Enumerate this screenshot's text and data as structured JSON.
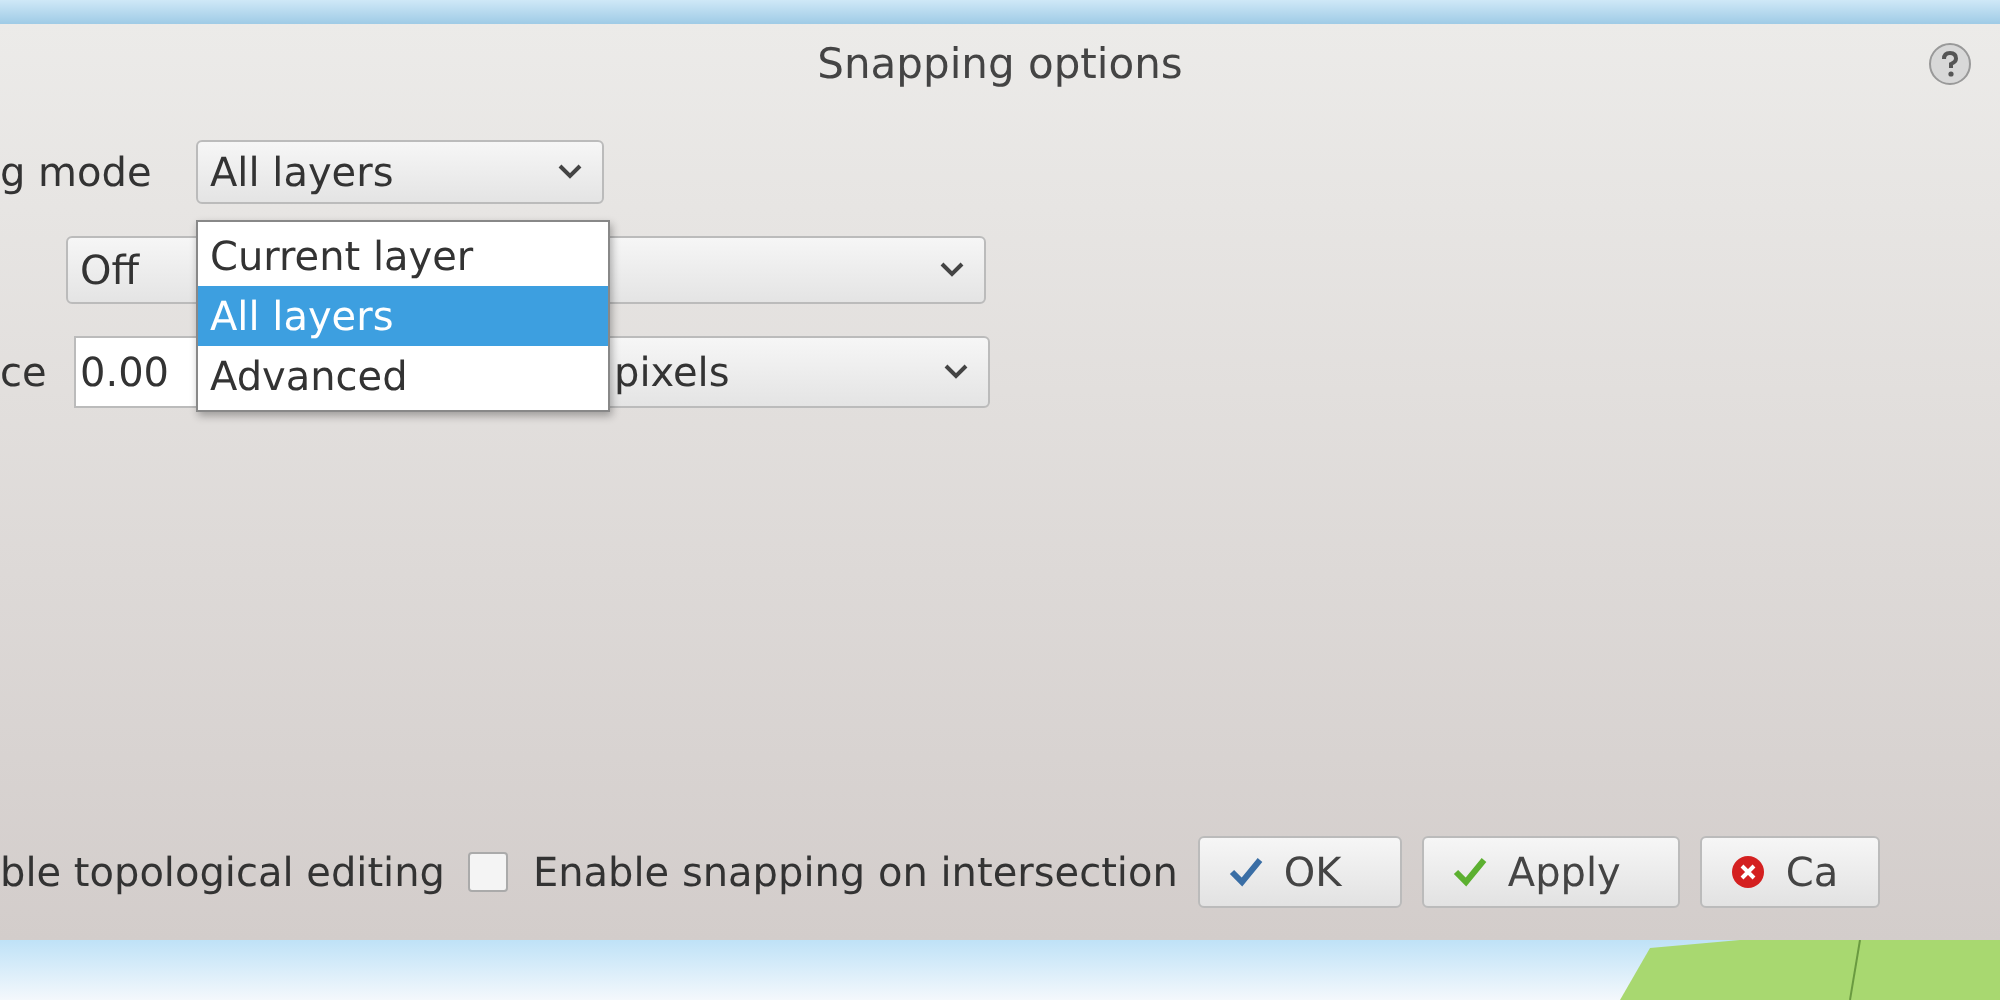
{
  "window": {
    "title": "Snapping options"
  },
  "snapping_mode": {
    "label": "g mode",
    "value": "All layers",
    "options": [
      {
        "label": "Current layer",
        "selected": false
      },
      {
        "label": "All layers",
        "selected": true
      },
      {
        "label": "Advanced",
        "selected": false
      }
    ]
  },
  "snap_to": {
    "value": "Off"
  },
  "tolerance": {
    "label": "ce",
    "value": "0.00",
    "unit": "pixels"
  },
  "options": [
    {
      "label": "ble topological editing"
    },
    {
      "label": "Enable snapping on intersection",
      "checked": false
    }
  ],
  "buttons": [
    {
      "label": "OK",
      "kind": "ok"
    },
    {
      "label": "Apply",
      "kind": "apply"
    },
    {
      "label": "Ca",
      "kind": "cancel"
    }
  ]
}
